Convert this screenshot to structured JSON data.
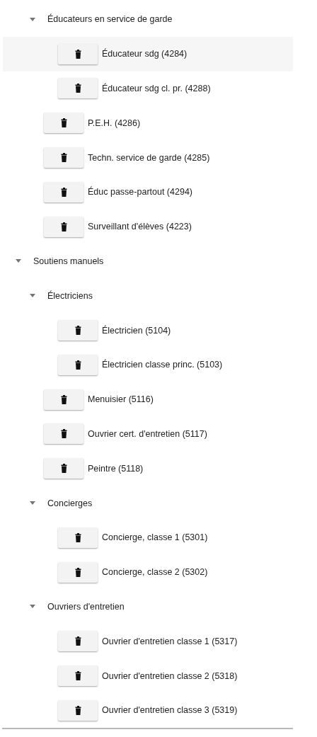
{
  "tree_continued": [
    {
      "kind": "group",
      "label": "Éducateurs en service de garde",
      "expanded": true,
      "children": [
        {
          "kind": "leaf",
          "label": "Éducateur sdg (4284)",
          "selected": true
        },
        {
          "kind": "leaf",
          "label": "Éducateur sdg cl. pr. (4288)",
          "selected": false
        }
      ]
    },
    {
      "kind": "leaf",
      "label": "P.E.H. (4286)",
      "selected": false
    },
    {
      "kind": "leaf",
      "label": "Techn. service de garde (4285)",
      "selected": false
    },
    {
      "kind": "leaf",
      "label": "Éduc passe-partout (4294)",
      "selected": false
    },
    {
      "kind": "leaf",
      "label": "Surveillant d'élèves (4223)",
      "selected": false
    }
  ],
  "tree": [
    {
      "kind": "group",
      "label": "Soutiens manuels",
      "expanded": true,
      "children": [
        {
          "kind": "group",
          "label": "Électriciens",
          "expanded": true,
          "children": [
            {
              "kind": "leaf",
              "label": "Électricien (5104)",
              "selected": false
            },
            {
              "kind": "leaf",
              "label": "Électricien classe princ. (5103)",
              "selected": false
            }
          ]
        },
        {
          "kind": "leaf",
          "label": "Menuisier (5116)",
          "selected": false
        },
        {
          "kind": "leaf",
          "label": "Ouvrier cert. d'entretien (5117)",
          "selected": false
        },
        {
          "kind": "leaf",
          "label": "Peintre (5118)",
          "selected": false
        },
        {
          "kind": "group",
          "label": "Concierges",
          "expanded": true,
          "children": [
            {
              "kind": "leaf",
              "label": "Concierge, classe 1 (5301)",
              "selected": false
            },
            {
              "kind": "leaf",
              "label": "Concierge, classe 2 (5302)",
              "selected": false
            }
          ]
        },
        {
          "kind": "group",
          "label": "Ouvriers d'entretien",
          "expanded": true,
          "children": [
            {
              "kind": "leaf",
              "label": "Ouvrier d'entretien classe 1 (5317)",
              "selected": false
            },
            {
              "kind": "leaf",
              "label": "Ouvrier d'entretien classe 2 (5318)",
              "selected": false
            },
            {
              "kind": "leaf",
              "label": "Ouvrier d'entretien classe 3 (5319)",
              "selected": false
            }
          ]
        }
      ]
    }
  ]
}
